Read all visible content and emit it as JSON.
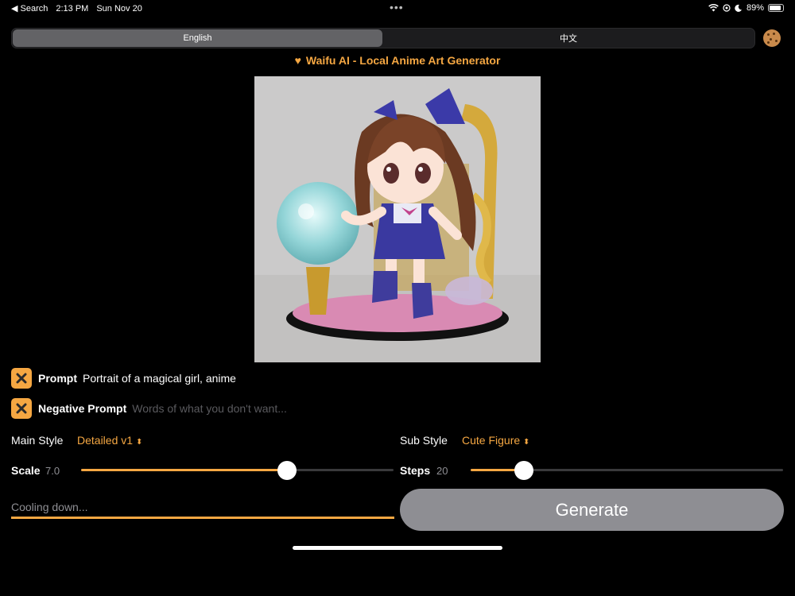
{
  "status_bar": {
    "back_app": "◀ Search",
    "time": "2:13 PM",
    "date": "Sun Nov 20",
    "more": "•••",
    "battery": "89%",
    "battery_level": 0.89
  },
  "language_tabs": [
    {
      "label": "English",
      "selected": true
    },
    {
      "label": "中文",
      "selected": false
    }
  ],
  "title": {
    "icon": "orange-heart-icon",
    "text": "Waifu AI - Local Anime Art Generator"
  },
  "prompt": {
    "label": "Prompt",
    "value": "Portrait of a magical girl, anime"
  },
  "negative_prompt": {
    "label": "Negative Prompt",
    "placeholder": "Words of what you don't want..."
  },
  "main_style": {
    "label": "Main Style",
    "value": "Detailed v1"
  },
  "sub_style": {
    "label": "Sub Style",
    "value": "Cute Figure"
  },
  "scale": {
    "label": "Scale",
    "value": "7.0",
    "fraction": 0.66
  },
  "steps": {
    "label": "Steps",
    "value": "20",
    "fraction": 0.17
  },
  "status_text": "Cooling down...",
  "generate_label": "Generate",
  "colors": {
    "accent": "#f5a742",
    "button_disabled": "#8e8e93"
  }
}
